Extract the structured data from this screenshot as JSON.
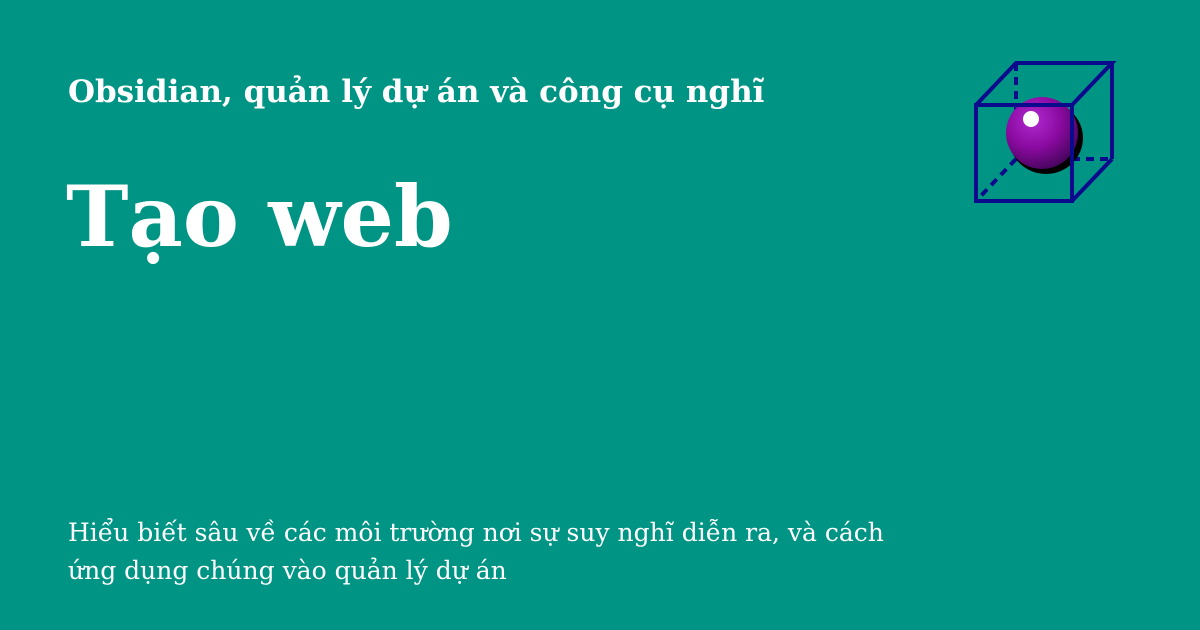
{
  "header": {
    "site_name": "Obsidian, quản lý dự án và công cụ nghĩ"
  },
  "main": {
    "title": "Tạo web",
    "description": "Hiểu biết sâu về các môi trường nơi sự suy nghĩ diễn ra, và cách ứng dụng chúng vào quản lý dự án"
  },
  "logo": {
    "icon": "cube-with-sphere-icon"
  },
  "colors": {
    "background": "#009485",
    "text": "#ffffff",
    "cube": "#0a0a8c",
    "sphere": "#8a0aa0"
  }
}
